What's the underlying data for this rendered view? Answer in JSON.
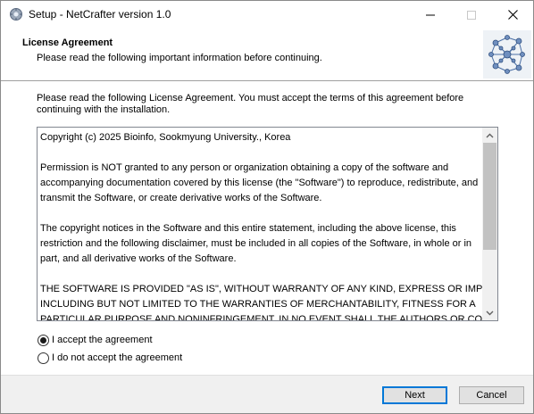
{
  "window": {
    "title": "Setup - NetCrafter version 1.0"
  },
  "header": {
    "title": "License Agreement",
    "subtitle": "Please read the following important information before continuing.",
    "logo_icon": "network-graph-logo-icon"
  },
  "intro": {
    "text": "Please read the following License Agreement. You must accept the terms of this agreement before continuing with the installation."
  },
  "license": {
    "lines": [
      "Copyright (c) 2025 Bioinfo, Sookmyung University., Korea",
      "",
      "Permission is NOT granted to any person or organization obtaining a copy of the software and",
      "accompanying documentation covered by this license (the \"Software\") to reproduce, redistribute, and",
      "transmit the Software, or create derivative works of the Software.",
      "",
      "The copyright notices in the Software and this entire statement, including the above license, this",
      "restriction and the following disclaimer, must be included in all copies of the Software, in whole or in",
      "part, and all derivative works of the Software.",
      "",
      "THE SOFTWARE IS PROVIDED \"AS IS\", WITHOUT WARRANTY OF ANY KIND, EXPRESS OR IMPLIED,",
      "INCLUDING BUT NOT LIMITED TO THE WARRANTIES OF MERCHANTABILITY, FITNESS FOR A",
      "PARTICULAR PURPOSE AND NONINFRINGEMENT. IN NO EVENT SHALL THE AUTHORS OR COPYRIGHT"
    ],
    "scroll_position": 0
  },
  "options": {
    "accept_label": "I accept the agreement",
    "decline_label": "I do not accept the agreement",
    "selected": "accept"
  },
  "buttons": {
    "next": "Next",
    "cancel": "Cancel"
  },
  "colors": {
    "default_button_border": "#0078d7",
    "footer_bg": "#f0f0f0"
  }
}
